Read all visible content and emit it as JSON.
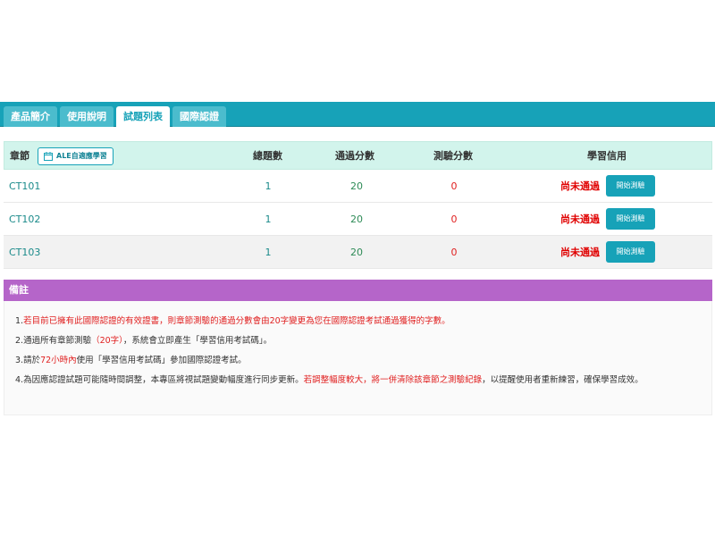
{
  "tabs": [
    {
      "label": "產品簡介"
    },
    {
      "label": "使用說明"
    },
    {
      "label": "試題列表"
    },
    {
      "label": "國際認證"
    }
  ],
  "table": {
    "headers": {
      "chapter": "章節",
      "ale_button": "ALE自適應學習",
      "total": "總題數",
      "pass_score": "通過分數",
      "test_score": "測驗分數",
      "credit": "學習信用"
    },
    "rows": [
      {
        "chapter": "CT101",
        "total": "1",
        "pass": "20",
        "score": "0",
        "status": "尚未通過",
        "button": "開始測驗"
      },
      {
        "chapter": "CT102",
        "total": "1",
        "pass": "20",
        "score": "0",
        "status": "尚未通過",
        "button": "開始測驗"
      },
      {
        "chapter": "CT103",
        "total": "1",
        "pass": "20",
        "score": "0",
        "status": "尚未通過",
        "button": "開始測驗"
      }
    ]
  },
  "notes": {
    "title": "備註",
    "n1": {
      "a": "1.",
      "b": "若目前已擁有此國際認證的有效證書，則章節測驗的通過分數會由20字變更為您在國際認證考試通過獲得的字數。"
    },
    "n2": {
      "a": "2.通過所有章節測驗",
      "b": "（20字）",
      "c": "，系統會立即產生「學習信用考試碼」。"
    },
    "n3": {
      "a": "3.請於",
      "b": "72小時內",
      "c": "使用「學習信用考試碼」參加國際認證考試。"
    },
    "n4": {
      "a": "4.為因應認證試題可能隨時間調整，本專區將視試題變動幅度進行同步更新。",
      "b": "若調整幅度較大，將一併清除該章節之測驗紀錄",
      "c": "，以提醒使用者重新練習，確保學習成效。"
    }
  },
  "icons": {
    "ale": "calendar-icon"
  },
  "colors": {
    "tabbar": "#17a2b8",
    "table_header": "#d2f4ec",
    "notes_header": "#b565c9",
    "fail": "#e00000"
  }
}
